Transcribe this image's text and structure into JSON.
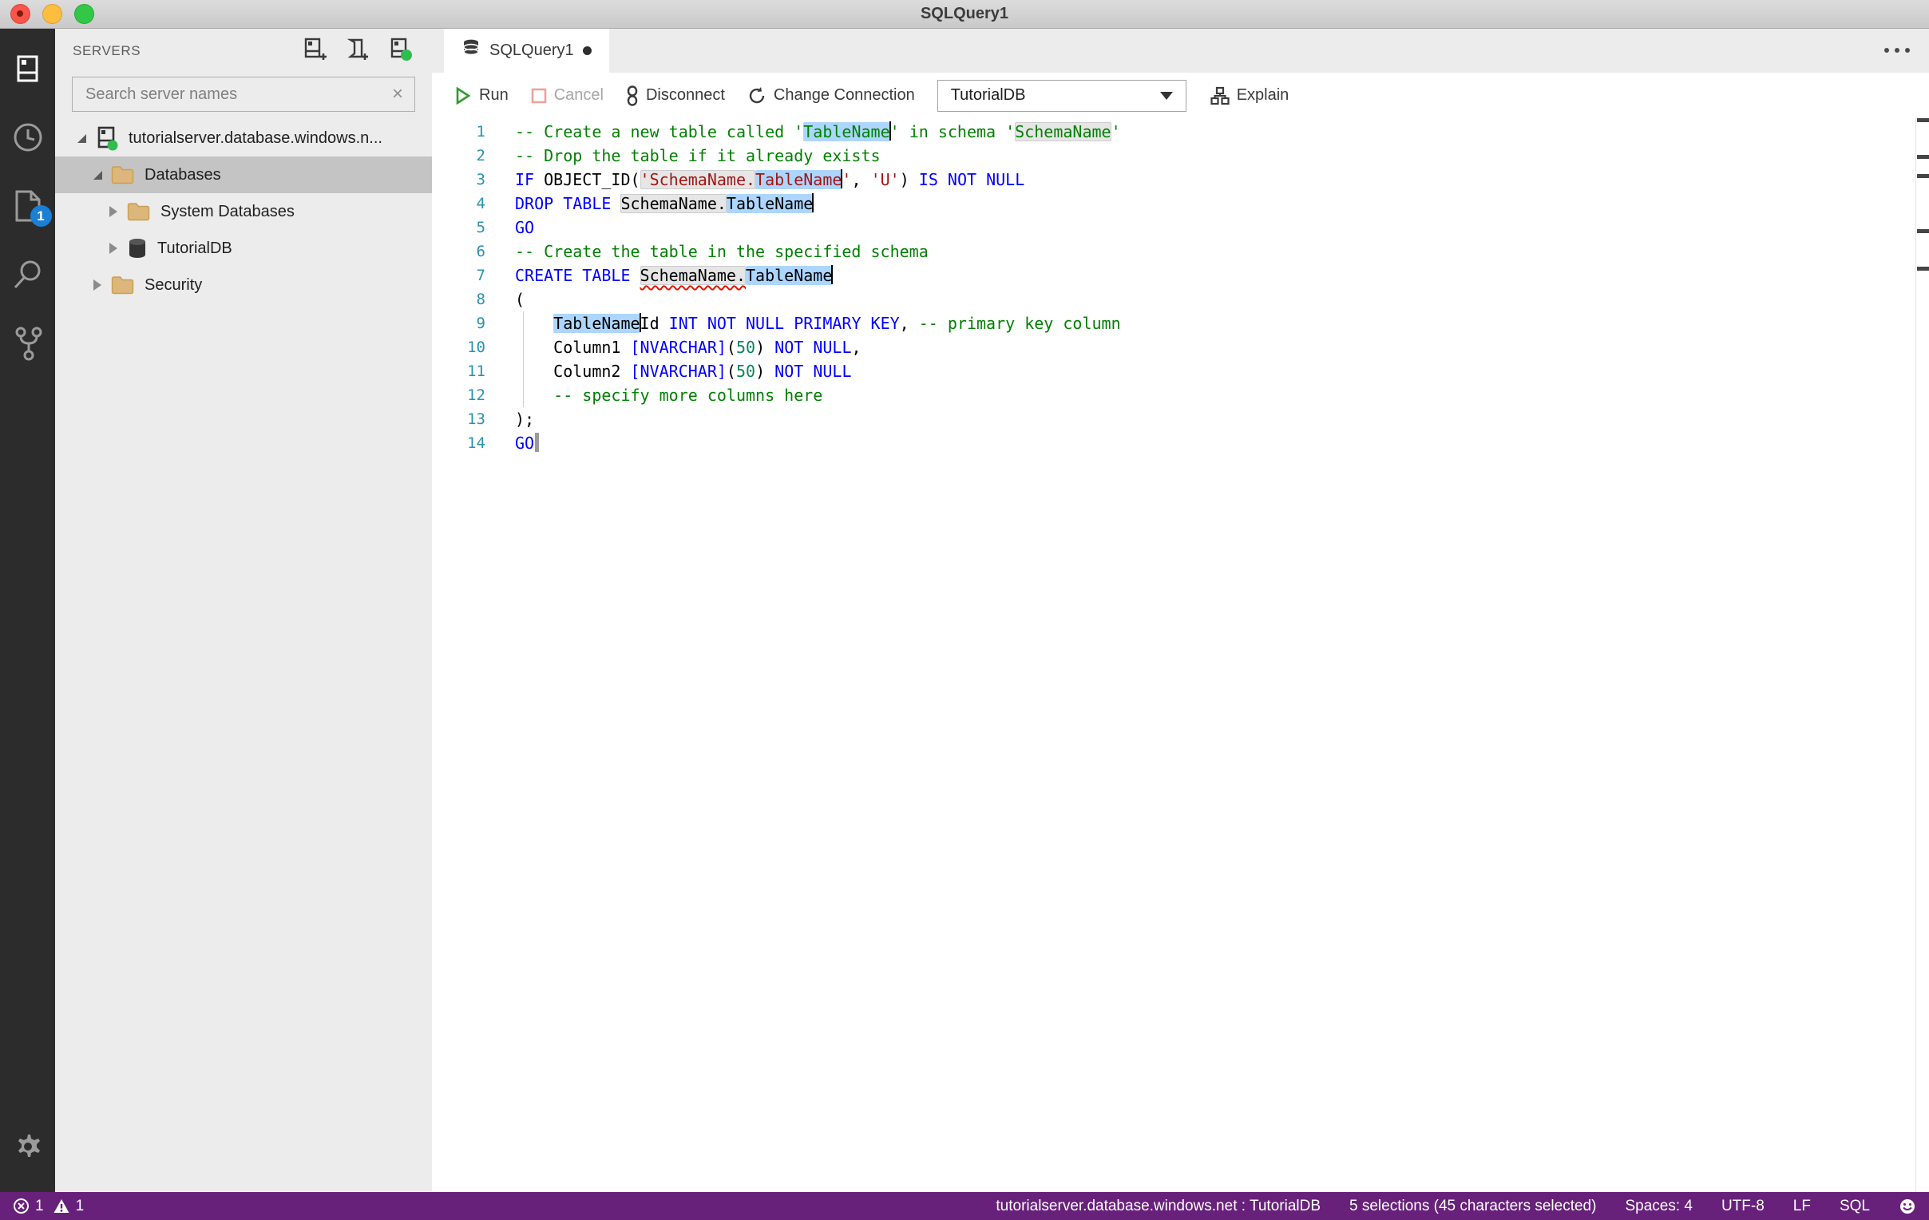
{
  "window": {
    "title": "SQLQuery1"
  },
  "activity_bar": {
    "items": [
      "servers",
      "task-history",
      "open-editors",
      "search",
      "source-control"
    ],
    "open_editors_badge": "1"
  },
  "sidebar": {
    "header": "SERVERS",
    "actions": [
      "new-connection",
      "new-server-group",
      "active-connections"
    ],
    "search": {
      "placeholder": "Search server names",
      "clear_icon": "×"
    },
    "tree": [
      {
        "label": "tutorialserver.database.windows.n...",
        "icon": "server",
        "level": 0,
        "expanded": true,
        "selected": false
      },
      {
        "label": "Databases",
        "icon": "folder",
        "level": 1,
        "expanded": true,
        "selected": true
      },
      {
        "label": "System Databases",
        "icon": "folder",
        "level": 2,
        "expanded": false,
        "selected": false
      },
      {
        "label": "TutorialDB",
        "icon": "database",
        "level": 2,
        "expanded": false,
        "selected": false
      },
      {
        "label": "Security",
        "icon": "folder",
        "level": 1,
        "expanded": false,
        "selected": false
      }
    ]
  },
  "tab": {
    "label": "SQLQuery1",
    "dirty": true
  },
  "toolbar": {
    "run": "Run",
    "cancel": "Cancel",
    "disconnect": "Disconnect",
    "change_connection": "Change Connection",
    "database": "TutorialDB",
    "explain": "Explain"
  },
  "editor": {
    "overview_marks": [
      1,
      3,
      4,
      7,
      9
    ],
    "lines": [
      {
        "tokens": [
          {
            "t": "-- Create a new table called '",
            "c": "cm"
          },
          {
            "t": "TableName",
            "c": "cm",
            "sel": true
          },
          {
            "cur": "k"
          },
          {
            "t": "' in schema '",
            "c": "cm"
          },
          {
            "t": "SchemaName",
            "c": "cm",
            "occ": true
          },
          {
            "t": "'",
            "c": "cm"
          }
        ]
      },
      {
        "tokens": [
          {
            "t": "-- Drop the table if it already exists",
            "c": "cm"
          }
        ]
      },
      {
        "tokens": [
          {
            "t": "IF",
            "c": "kw"
          },
          {
            "t": " OBJECT_ID(",
            "c": "id"
          },
          {
            "t": "'SchemaName.",
            "c": "str",
            "occ": true
          },
          {
            "t": "TableName",
            "c": "str",
            "sel": true
          },
          {
            "cur": "k"
          },
          {
            "t": "'",
            "c": "str"
          },
          {
            "t": ", ",
            "c": "id"
          },
          {
            "t": "'U'",
            "c": "str"
          },
          {
            "t": ")",
            "c": "id"
          },
          {
            "t": " ",
            "c": "id"
          },
          {
            "t": "IS NOT NULL",
            "c": "kw"
          }
        ]
      },
      {
        "tokens": [
          {
            "t": "DROP TABLE",
            "c": "kw"
          },
          {
            "t": " ",
            "c": "id"
          },
          {
            "t": "SchemaName.",
            "c": "id",
            "occ": true
          },
          {
            "t": "TableName",
            "c": "id",
            "sel": true
          },
          {
            "cur": "k"
          }
        ]
      },
      {
        "tokens": [
          {
            "t": "GO",
            "c": "kw"
          }
        ]
      },
      {
        "tokens": [
          {
            "t": "-- Create the table in the specified schema",
            "c": "cm"
          }
        ]
      },
      {
        "tokens": [
          {
            "t": "CREATE TABLE",
            "c": "kw"
          },
          {
            "t": " ",
            "c": "id"
          },
          {
            "t": "SchemaName.",
            "c": "id",
            "occ": true,
            "sq": true
          },
          {
            "t": "TableName",
            "c": "id",
            "sel": true
          },
          {
            "cur": "k"
          }
        ]
      },
      {
        "tokens": [
          {
            "t": "(",
            "c": "id"
          }
        ]
      },
      {
        "guide": true,
        "tokens": [
          {
            "t": "    ",
            "c": "id"
          },
          {
            "t": "TableName",
            "c": "id",
            "sel": true
          },
          {
            "cur": "k"
          },
          {
            "t": "Id ",
            "c": "id"
          },
          {
            "t": "INT NOT NULL PRIMARY KEY",
            "c": "kw"
          },
          {
            "t": ", ",
            "c": "id"
          },
          {
            "t": "-- primary key column",
            "c": "cm"
          }
        ]
      },
      {
        "guide": true,
        "tokens": [
          {
            "t": "    Column1 ",
            "c": "id"
          },
          {
            "t": "[NVARCHAR]",
            "c": "kw"
          },
          {
            "t": "(",
            "c": "id"
          },
          {
            "t": "50",
            "c": "num"
          },
          {
            "t": ") ",
            "c": "id"
          },
          {
            "t": "NOT NULL",
            "c": "kw"
          },
          {
            "t": ",",
            "c": "id"
          }
        ]
      },
      {
        "guide": true,
        "tokens": [
          {
            "t": "    Column2 ",
            "c": "id"
          },
          {
            "t": "[NVARCHAR]",
            "c": "kw"
          },
          {
            "t": "(",
            "c": "id"
          },
          {
            "t": "50",
            "c": "num"
          },
          {
            "t": ") ",
            "c": "id"
          },
          {
            "t": "NOT NULL",
            "c": "kw"
          }
        ]
      },
      {
        "guide": true,
        "tokens": [
          {
            "t": "    ",
            "c": "id"
          },
          {
            "t": "-- specify more columns here",
            "c": "cm"
          }
        ]
      },
      {
        "tokens": [
          {
            "t": ");",
            "c": "id"
          }
        ]
      },
      {
        "tokens": [
          {
            "t": "GO",
            "c": "kw"
          },
          {
            "cur": "g"
          }
        ]
      }
    ]
  },
  "status_bar": {
    "errors": "1",
    "warnings": "1",
    "connection": "tutorialserver.database.windows.net : TutorialDB",
    "selections": "5 selections (45 characters selected)",
    "spaces": "Spaces: 4",
    "encoding": "UTF-8",
    "eol": "LF",
    "language": "SQL"
  },
  "colors": {
    "statusbar": "#68217A",
    "badge": "#1B7FD4",
    "selection": "#ADD6FF",
    "occurrence": "#E6E6E6",
    "keyword": "#0000FF",
    "comment": "#008000",
    "string": "#A31515",
    "number": "#098658",
    "line_number": "#2B91AF",
    "folder": "#DCB67A",
    "connected_green": "#2EBD4E",
    "activity_bar": "#2C2C2C",
    "sidebar": "#ECECEC"
  }
}
